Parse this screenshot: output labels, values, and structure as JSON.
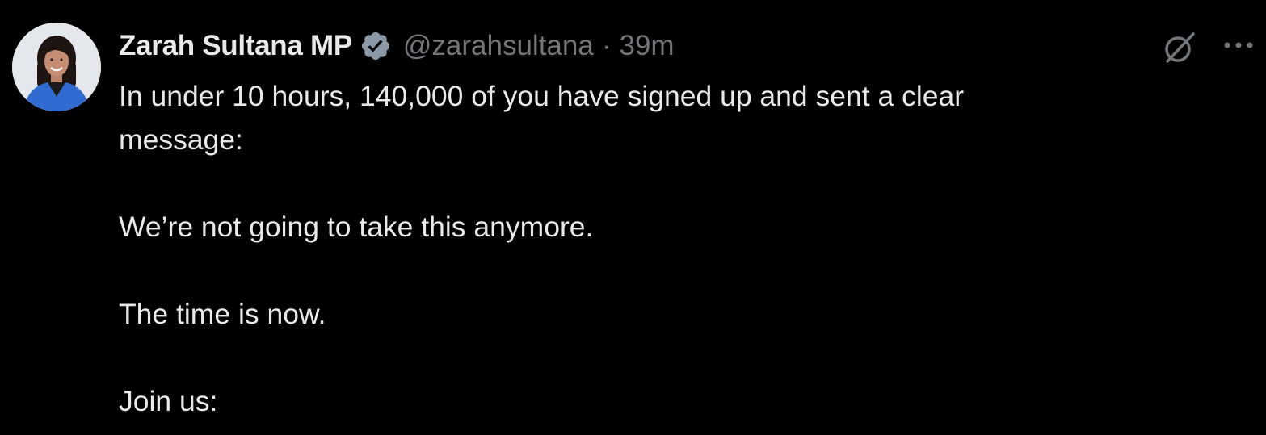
{
  "tweet": {
    "author": {
      "display_name": "Zarah Sultana MP",
      "handle": "@zarahsultana",
      "separator": "·",
      "timestamp": "39m",
      "verified": true,
      "avatar_icon": "avatar-portrait"
    },
    "text": {
      "line1": "In under 10 hours, 140,000 of you have signed up and sent a clear",
      "line2": "message:",
      "para2": "We’re not going to take this anymore.",
      "para3": "The time is now.",
      "para4": "Join us:"
    },
    "actions": {
      "grok_icon": "grok-icon",
      "more_icon": "more-options-icon"
    }
  },
  "colors": {
    "background": "#000000",
    "primary_text": "#e7e9ea",
    "secondary_text": "#71767b",
    "verified_badge": "#8b98a5",
    "avatar_jacket": "#2f6bd1"
  }
}
